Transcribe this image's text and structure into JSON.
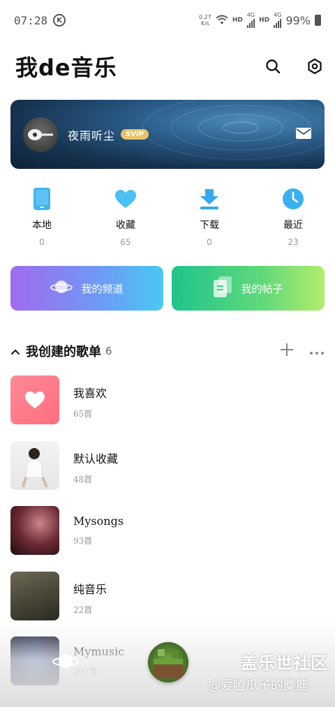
{
  "status_bar": {
    "time": "07:28",
    "carrier_badge": "K",
    "net_speed_value": "0.27",
    "net_speed_unit": "K/s",
    "hd1": "HD",
    "net1": "4G",
    "hd2": "HD",
    "net2": "4G",
    "battery": "99%"
  },
  "header": {
    "title": "我de音乐",
    "icons": [
      "search-icon",
      "settings-icon"
    ]
  },
  "profile": {
    "username": "夜雨听尘",
    "vip_badge": "SVIP",
    "icons": [
      "avatar-guitar",
      "mail-icon"
    ]
  },
  "quick_access": [
    {
      "label": "本地",
      "count": "0",
      "icon": "phone-icon",
      "color": "#3fb4f0"
    },
    {
      "label": "收藏",
      "count": "65",
      "icon": "heart-icon",
      "color": "#4cc0f2"
    },
    {
      "label": "下载",
      "count": "0",
      "icon": "download-icon",
      "color": "#36a9ee"
    },
    {
      "label": "最近",
      "count": "23",
      "icon": "clock-icon",
      "color": "#3bb0f0"
    }
  ],
  "cards": {
    "channel": "我的频道",
    "posts": "我的帖子"
  },
  "section": {
    "title": "我创建的歌单",
    "count": "6",
    "icons": [
      "collapse-chevron-icon",
      "add-icon",
      "more-icon"
    ]
  },
  "playlists": [
    {
      "name": "我喜欢",
      "count": "65首"
    },
    {
      "name": "默认收藏",
      "count": "48首"
    },
    {
      "name": "Mysongs",
      "count": "93首"
    },
    {
      "name": "纯音乐",
      "count": "22首"
    },
    {
      "name": "Mymusic",
      "count": "207首"
    }
  ],
  "watermark": {
    "line1": "盖乐世社区",
    "line2": "@爱嗑瓜子的麋鹿"
  },
  "colors": {
    "accent_blue": "#3fb4f0",
    "vip_gold": "#e9c36a",
    "like_pink": "#ff7a89"
  }
}
